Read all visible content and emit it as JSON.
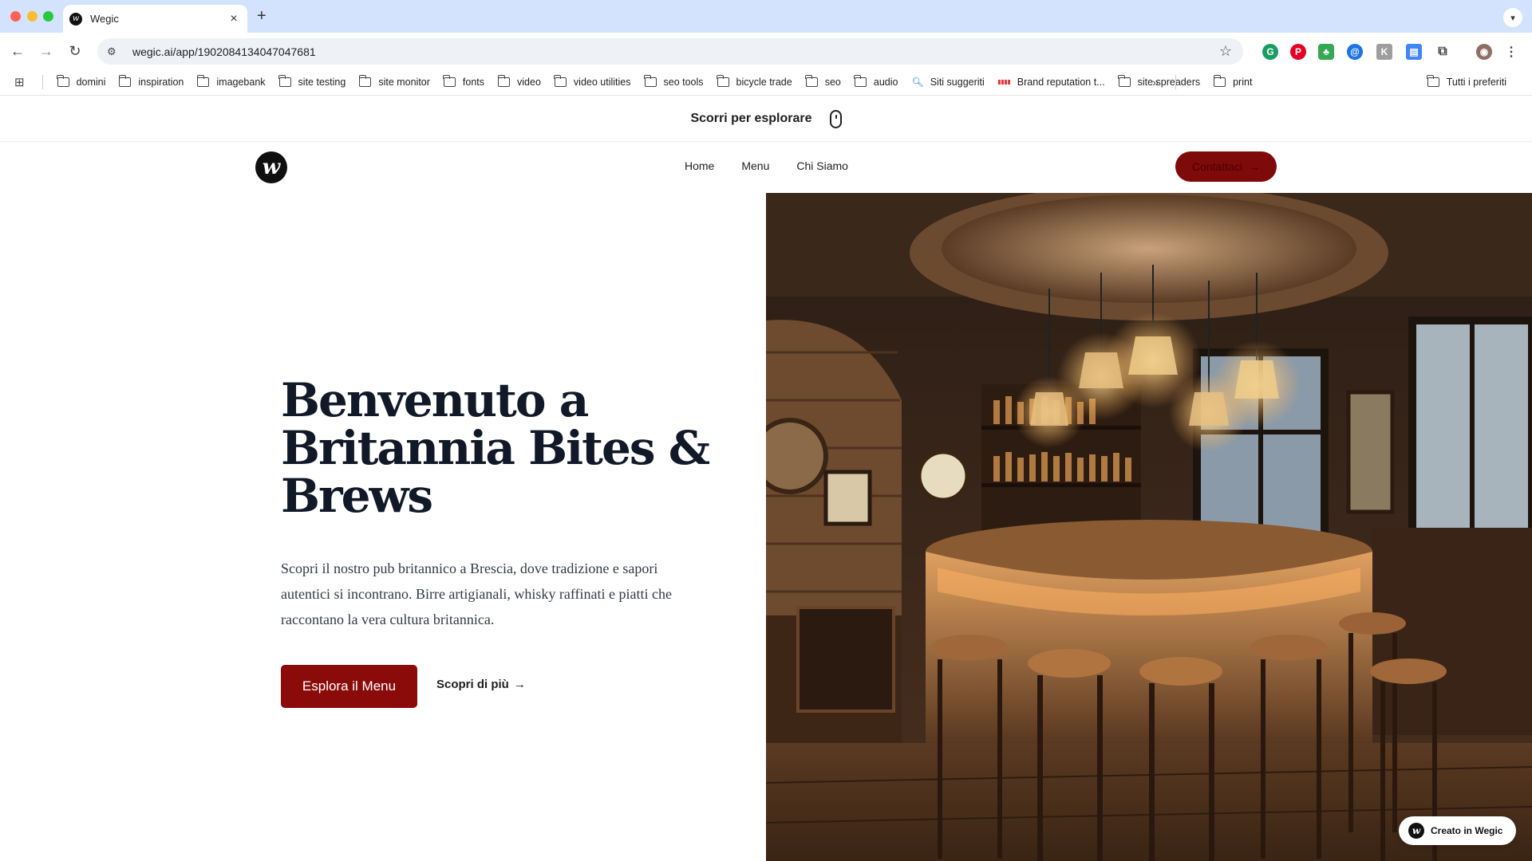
{
  "browser": {
    "tab": {
      "title": "Wegic",
      "favicon": "wegic-logo-icon"
    },
    "new_tab": "+",
    "url": "wegic.ai/app/1902084134047047681",
    "bookmarks": [
      {
        "label": "domini",
        "icon": "folder-icon"
      },
      {
        "label": "inspiration",
        "icon": "folder-icon"
      },
      {
        "label": "imagebank",
        "icon": "folder-icon"
      },
      {
        "label": "site testing",
        "icon": "folder-icon"
      },
      {
        "label": "site monitor",
        "icon": "folder-icon"
      },
      {
        "label": "fonts",
        "icon": "folder-icon"
      },
      {
        "label": "video",
        "icon": "folder-icon"
      },
      {
        "label": "video utilities",
        "icon": "folder-icon"
      },
      {
        "label": "seo tools",
        "icon": "folder-icon"
      },
      {
        "label": "bicycle trade",
        "icon": "folder-icon"
      },
      {
        "label": "seo",
        "icon": "folder-icon"
      },
      {
        "label": "audio",
        "icon": "folder-icon"
      },
      {
        "label": "Siti suggeriti",
        "icon": "search-icon"
      },
      {
        "label": "Brand reputation t...",
        "icon": "brand-icon"
      },
      {
        "label": "site spreaders",
        "icon": "folder-icon"
      },
      {
        "label": "print",
        "icon": "folder-icon"
      }
    ],
    "all_bookmarks": "Tutti i preferiti",
    "more": "»"
  },
  "page": {
    "scroll_hint": "Scorri per esplorare",
    "nav": {
      "links": [
        "Home",
        "Menu",
        "Chi Siamo"
      ],
      "contact": "Contattaci"
    },
    "hero": {
      "title": "Benvenuto a Britannia Bites & Brews",
      "description": "Scopri il nostro pub britannico a Brescia, dove tradizione e sapori autentici si incontrano. Birre artigianali, whisky raffinati e piatti che raccontano la vera cultura britannica.",
      "primary_button": "Esplora il Menu",
      "secondary_link": "Scopri di più"
    },
    "badge": "Creato in Wegic"
  },
  "colors": {
    "brand_red": "#8b0b0b",
    "tab_strip": "#d3e3fd",
    "title": "#111827"
  }
}
